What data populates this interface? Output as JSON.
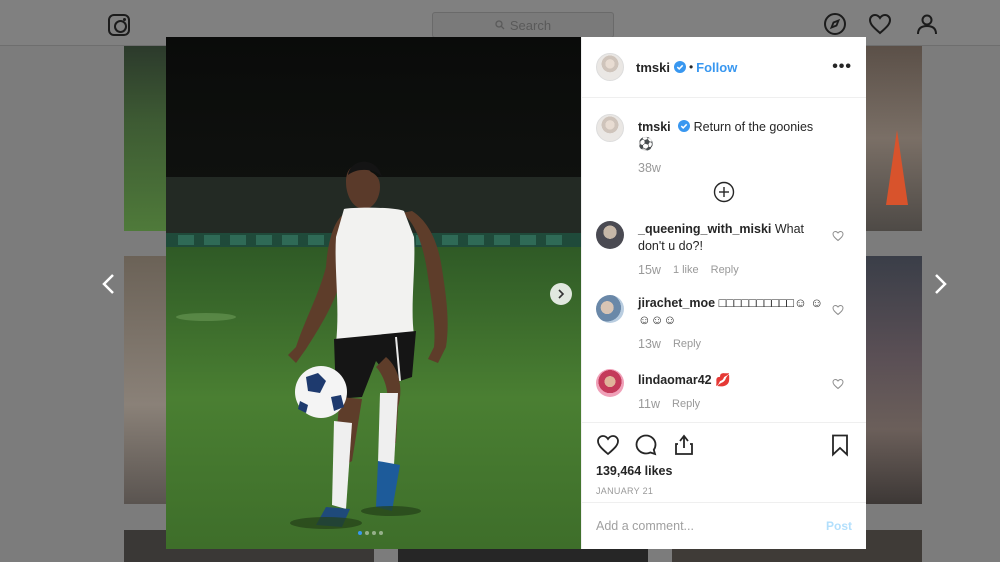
{
  "topbar": {
    "search_placeholder": "Search",
    "icons": [
      "instagram-logo-icon",
      "compass-icon",
      "heart-icon",
      "profile-icon"
    ]
  },
  "post": {
    "username": "tmski",
    "follow_label": "Follow",
    "more_label": "•••",
    "caption_username": "tmski",
    "caption_text": "Return of the goonies ⚽",
    "caption_time": "38w",
    "comments": [
      {
        "username": "_queening_with_miski",
        "text": "What don't u do?!",
        "time": "15w",
        "likes": "1 like",
        "reply": "Reply"
      },
      {
        "username": "jirachet_moe",
        "text": "□□□□□□□□□□☺ ☺☺☺☺",
        "time": "13w",
        "reply": "Reply"
      },
      {
        "username": "lindaomar42",
        "text": "💋",
        "time": "11w",
        "reply": "Reply"
      }
    ],
    "likes_text": "139,464 likes",
    "date_text": "JANUARY 21",
    "add_comment_placeholder": "Add a comment...",
    "post_label": "Post",
    "carousel": {
      "count": 4,
      "active": 1
    }
  },
  "colors": {
    "accent": "#3897f0",
    "post_disabled": "#b2dffc",
    "muted_text": "#999999"
  }
}
